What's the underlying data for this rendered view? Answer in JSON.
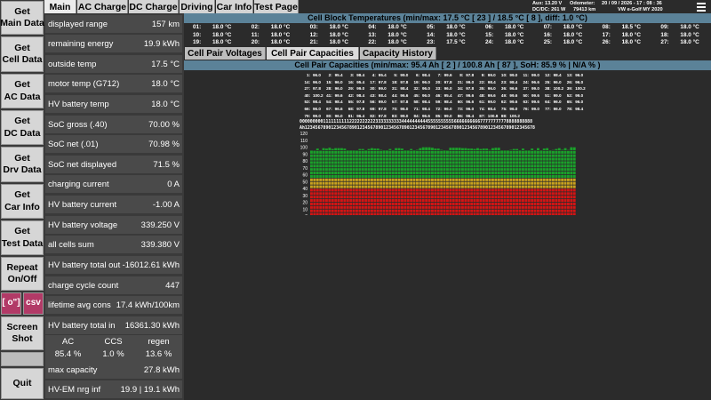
{
  "nav": [
    {
      "key": "main",
      "label": "Get\nMain Data"
    },
    {
      "key": "cell",
      "label": "Get\nCell Data"
    },
    {
      "key": "ac",
      "label": "Get\nAC Data"
    },
    {
      "key": "dc",
      "label": "Get\nDC Data"
    },
    {
      "key": "drv",
      "label": "Get\nDrv Data"
    },
    {
      "key": "car",
      "label": "Get\nCar Info"
    },
    {
      "key": "test",
      "label": "Get\nTest Data"
    },
    {
      "key": "repeat",
      "label": "Repeat\nOn/Off"
    },
    {
      "key": "rec",
      "label": "[ o\"]"
    },
    {
      "key": "csv",
      "label": "csv"
    },
    {
      "key": "screenshot",
      "label": "Screen\nShot"
    },
    {
      "key": "quit",
      "label": "Quit"
    }
  ],
  "tabs": [
    "Main",
    "AC Charge",
    "DC Charge",
    "Driving",
    "Car Info",
    "Test Page"
  ],
  "status": {
    "aux": "Aux: 13.20 V",
    "dcdc": "DC/DC: 261 W",
    "odometer_label": "Odometer:",
    "odometer": "79413 km",
    "datetime": "20 / 09 / 2026  -  17 : 08 : 36",
    "vehicle": "VW e-Golf MY 2020"
  },
  "data_rows": [
    {
      "label": "displayed range",
      "value": "157 km"
    },
    {
      "label": "remaining energy",
      "value": "19.9 kWh"
    },
    {
      "label": "outside temp",
      "value": "17.5 °C"
    },
    {
      "label": "motor temp (G712)",
      "value": "18.0 °C"
    },
    {
      "label": "HV battery temp",
      "value": "18.0 °C"
    },
    {
      "label": "SoC gross (.40)",
      "value": "70.00 %"
    },
    {
      "label": "SoC net (.01)",
      "value": "70.98 %"
    },
    {
      "label": "SoC net displayed",
      "value": "71.5 %"
    },
    {
      "label": "charging current",
      "value": "0 A"
    },
    {
      "label": "HV battery current",
      "value": "-1.00 A"
    },
    {
      "label": "HV battery voltage",
      "value": "339.250 V"
    },
    {
      "label": "all cells sum",
      "value": "339.380 V"
    },
    {
      "label": "HV battery total out",
      "value": "-16012.61 kWh"
    },
    {
      "label": "charge cycle count",
      "value": "447"
    },
    {
      "label": "lifetime avg cons",
      "value": "17.4 kWh/100km"
    },
    {
      "label": "HV battery total in",
      "value": "16361.30 kWh"
    }
  ],
  "split": {
    "headers": [
      "AC",
      "CCS",
      "regen"
    ],
    "values": [
      "85.4 %",
      "1.0 %",
      "13.6 %"
    ]
  },
  "data_rows_bottom": [
    {
      "label": "max capacity",
      "value": "27.8 kWh"
    },
    {
      "label": "HV-EM nrg inf",
      "value": "19.9 | 19.1 kWh"
    }
  ],
  "temp_header": "Cell Block Temperatures (min/max:  17.5 °C [ 23 ]  /  18.5 °C [ 8 ],  diff:  1.0 °C)",
  "temps": [
    [
      "01:",
      "18.0 °C"
    ],
    [
      "02:",
      "18.0 °C"
    ],
    [
      "03:",
      "18.0 °C"
    ],
    [
      "04:",
      "18.0 °C"
    ],
    [
      "05:",
      "18.0 °C"
    ],
    [
      "06:",
      "18.0 °C"
    ],
    [
      "07:",
      "18.0 °C"
    ],
    [
      "08:",
      "18.5 °C"
    ],
    [
      "09:",
      "18.0 °C"
    ],
    [
      "10:",
      "18.0 °C"
    ],
    [
      "11:",
      "18.0 °C"
    ],
    [
      "12:",
      "18.0 °C"
    ],
    [
      "13:",
      "18.0 °C"
    ],
    [
      "14:",
      "18.0 °C"
    ],
    [
      "15:",
      "18.0 °C"
    ],
    [
      "16:",
      "18.0 °C"
    ],
    [
      "17:",
      "18.0 °C"
    ],
    [
      "18:",
      "18.0 °C"
    ],
    [
      "19:",
      "18.0 °C"
    ],
    [
      "20:",
      "18.0 °C"
    ],
    [
      "21:",
      "18.0 °C"
    ],
    [
      "22:",
      "18.0 °C"
    ],
    [
      "23:",
      "17.5 °C"
    ],
    [
      "24:",
      "18.0 °C"
    ],
    [
      "25:",
      "18.0 °C"
    ],
    [
      "26:",
      "18.0 °C"
    ],
    [
      "27:",
      "18.0 °C"
    ]
  ],
  "subtabs": [
    "Cell Pair Voltages",
    "Cell Pair Capacities",
    "Capacity History"
  ],
  "cap_header": "Cell Pair Capacities (min/max:  95.4 Ah [ 2 ]  /  100.8 Ah [ 87 ],  SoH:  85.9 %  |  N/A % )",
  "capacities": [
    [
      "1:",
      "96.0"
    ],
    [
      "2:",
      "95.4"
    ],
    [
      "3:",
      "98.4"
    ],
    [
      "4:",
      "95.4"
    ],
    [
      "5:",
      "99.0"
    ],
    [
      "6:",
      "98.4"
    ],
    [
      "7:",
      "99.6"
    ],
    [
      "8:",
      "97.8"
    ],
    [
      "9:",
      "99.0"
    ],
    [
      "10:",
      "99.0"
    ],
    [
      "11:",
      "99.0"
    ],
    [
      "12:",
      "98.4"
    ],
    [
      "13:",
      "96.0"
    ],
    [
      "14:",
      "96.0"
    ],
    [
      "15:",
      "96.0"
    ],
    [
      "16:",
      "95.4"
    ],
    [
      "17:",
      "97.8"
    ],
    [
      "18:",
      "97.8"
    ],
    [
      "19:",
      "96.0"
    ],
    [
      "20:",
      "97.8"
    ],
    [
      "21:",
      "99.0"
    ],
    [
      "22:",
      "98.4"
    ],
    [
      "23:",
      "98.4"
    ],
    [
      "24:",
      "96.6"
    ],
    [
      "25:",
      "96.0"
    ],
    [
      "26:",
      "96.0"
    ],
    [
      "27:",
      "97.8"
    ],
    [
      "28:",
      "96.0"
    ],
    [
      "29:",
      "99.0"
    ],
    [
      "30:",
      "99.0"
    ],
    [
      "31:",
      "98.4"
    ],
    [
      "32:",
      "96.0"
    ],
    [
      "33:",
      "96.0"
    ],
    [
      "34:",
      "97.8"
    ],
    [
      "35:",
      "96.0"
    ],
    [
      "36:",
      "96.6"
    ],
    [
      "37:",
      "99.0"
    ],
    [
      "38:",
      "100.2"
    ],
    [
      "39:",
      "100.2"
    ],
    [
      "40:",
      "100.2"
    ],
    [
      "41:",
      "99.6"
    ],
    [
      "42:",
      "98.4"
    ],
    [
      "43:",
      "98.4"
    ],
    [
      "44:",
      "96.6"
    ],
    [
      "45:",
      "96.0"
    ],
    [
      "46:",
      "95.4"
    ],
    [
      "47:",
      "99.6"
    ],
    [
      "48:",
      "99.6"
    ],
    [
      "49:",
      "99.6"
    ],
    [
      "50:",
      "99.6"
    ],
    [
      "51:",
      "99.0"
    ],
    [
      "52:",
      "99.0"
    ],
    [
      "53:",
      "98.4"
    ],
    [
      "54:",
      "98.4"
    ],
    [
      "55:",
      "97.8"
    ],
    [
      "56:",
      "99.0"
    ],
    [
      "57:",
      "97.8"
    ],
    [
      "58:",
      "98.4"
    ],
    [
      "59:",
      "98.4"
    ],
    [
      "60:",
      "96.6"
    ],
    [
      "61:",
      "99.0"
    ],
    [
      "62:",
      "99.6"
    ],
    [
      "63:",
      "99.6"
    ],
    [
      "64:",
      "96.0"
    ],
    [
      "65:",
      "96.0"
    ],
    [
      "66:",
      "96.0"
    ],
    [
      "67:",
      "96.6"
    ],
    [
      "68:",
      "97.8"
    ],
    [
      "69:",
      "97.8"
    ],
    [
      "70:",
      "96.0"
    ],
    [
      "71:",
      "98.4"
    ],
    [
      "72:",
      "96.0"
    ],
    [
      "73:",
      "96.0"
    ],
    [
      "74:",
      "98.4"
    ],
    [
      "75:",
      "96.0"
    ],
    [
      "76:",
      "99.0"
    ],
    [
      "77:",
      "96.0"
    ],
    [
      "78:",
      "98.4"
    ],
    [
      "79:",
      "99.0"
    ],
    [
      "80:",
      "96.0"
    ],
    [
      "81:",
      "96.4"
    ],
    [
      "82:",
      "97.8"
    ],
    [
      "83:",
      "99.0"
    ],
    [
      "84:",
      "96.6"
    ],
    [
      "85:",
      "99.0"
    ],
    [
      "86:",
      "96.4"
    ],
    [
      "87:",
      "100.8"
    ],
    [
      "88:",
      "100.2"
    ]
  ],
  "chart_data": {
    "type": "bar",
    "title": "",
    "xlabel": "",
    "ylabel": "",
    "ylim": [
      0,
      120
    ],
    "yticks": [
      "120",
      "110",
      "100",
      "90",
      "80",
      "70",
      "60",
      "50",
      "40",
      "30",
      "20",
      "10",
      "0"
    ],
    "index_row_tens": "00000000011111111112222222222333333333344444444445555555555666666666677777777778888888888",
    "index_row_units": "Ah1234567890123456789012345678901234567890123456789012345678901234567890123456789012345678",
    "categories": [
      1,
      2,
      3,
      4,
      5,
      6,
      7,
      8,
      9,
      10,
      11,
      12,
      13,
      14,
      15,
      16,
      17,
      18,
      19,
      20,
      21,
      22,
      23,
      24,
      25,
      26,
      27,
      28,
      29,
      30,
      31,
      32,
      33,
      34,
      35,
      36,
      37,
      38,
      39,
      40,
      41,
      42,
      43,
      44,
      45,
      46,
      47,
      48,
      49,
      50,
      51,
      52,
      53,
      54,
      55,
      56,
      57,
      58,
      59,
      60,
      61,
      62,
      63,
      64,
      65,
      66,
      67,
      68,
      69,
      70,
      71,
      72,
      73,
      74,
      75,
      76,
      77,
      78,
      79,
      80,
      81,
      82,
      83,
      84,
      85,
      86,
      87,
      88
    ],
    "values": [
      96.0,
      95.4,
      98.4,
      95.4,
      99.0,
      98.4,
      99.6,
      97.8,
      99.0,
      99.0,
      99.0,
      98.4,
      96.0,
      96.0,
      96.0,
      95.4,
      97.8,
      97.8,
      96.0,
      97.8,
      99.0,
      98.4,
      98.4,
      96.6,
      96.0,
      96.0,
      97.8,
      96.0,
      99.0,
      99.0,
      98.4,
      96.0,
      96.0,
      97.8,
      96.0,
      96.6,
      99.0,
      100.2,
      100.2,
      100.2,
      99.6,
      98.4,
      98.4,
      96.6,
      96.0,
      95.4,
      99.6,
      99.6,
      99.6,
      99.6,
      99.0,
      99.0,
      98.4,
      98.4,
      97.8,
      99.0,
      97.8,
      98.4,
      98.4,
      96.6,
      99.0,
      99.6,
      99.6,
      96.0,
      96.0,
      96.0,
      96.6,
      97.8,
      97.8,
      96.0,
      98.4,
      96.0,
      96.0,
      98.4,
      96.0,
      99.0,
      96.0,
      98.4,
      99.0,
      96.0,
      96.4,
      97.8,
      99.0,
      96.6,
      99.0,
      96.4,
      100.8,
      100.2
    ],
    "colors": {
      "high": "#1aa12a",
      "mid": "#c9a21e",
      "low": "#d41414"
    }
  }
}
